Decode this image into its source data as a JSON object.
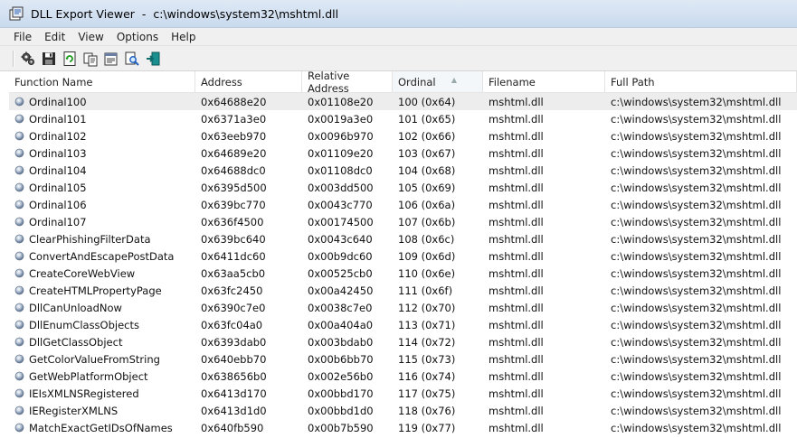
{
  "window": {
    "title": "DLL Export Viewer  -  c:\\windows\\system32\\mshtml.dll"
  },
  "menu": [
    "File",
    "Edit",
    "View",
    "Options",
    "Help"
  ],
  "toolbar": {
    "buttons": [
      "properties-gear-icon",
      "save-icon",
      "refresh-icon",
      "copy-icon",
      "html-report-icon",
      "find-icon",
      "exit-icon"
    ]
  },
  "table": {
    "columns": [
      "Function Name",
      "Address",
      "Relative Address",
      "Ordinal",
      "Filename",
      "Full Path"
    ],
    "sorted_column": "Ordinal",
    "rows": [
      [
        "Ordinal100",
        "0x64688e20",
        "0x01108e20",
        "100 (0x64)",
        "mshtml.dll",
        "c:\\windows\\system32\\mshtml.dll"
      ],
      [
        "Ordinal101",
        "0x6371a3e0",
        "0x0019a3e0",
        "101 (0x65)",
        "mshtml.dll",
        "c:\\windows\\system32\\mshtml.dll"
      ],
      [
        "Ordinal102",
        "0x63eeb970",
        "0x0096b970",
        "102 (0x66)",
        "mshtml.dll",
        "c:\\windows\\system32\\mshtml.dll"
      ],
      [
        "Ordinal103",
        "0x64689e20",
        "0x01109e20",
        "103 (0x67)",
        "mshtml.dll",
        "c:\\windows\\system32\\mshtml.dll"
      ],
      [
        "Ordinal104",
        "0x64688dc0",
        "0x01108dc0",
        "104 (0x68)",
        "mshtml.dll",
        "c:\\windows\\system32\\mshtml.dll"
      ],
      [
        "Ordinal105",
        "0x6395d500",
        "0x003dd500",
        "105 (0x69)",
        "mshtml.dll",
        "c:\\windows\\system32\\mshtml.dll"
      ],
      [
        "Ordinal106",
        "0x639bc770",
        "0x0043c770",
        "106 (0x6a)",
        "mshtml.dll",
        "c:\\windows\\system32\\mshtml.dll"
      ],
      [
        "Ordinal107",
        "0x636f4500",
        "0x00174500",
        "107 (0x6b)",
        "mshtml.dll",
        "c:\\windows\\system32\\mshtml.dll"
      ],
      [
        "ClearPhishingFilterData",
        "0x639bc640",
        "0x0043c640",
        "108 (0x6c)",
        "mshtml.dll",
        "c:\\windows\\system32\\mshtml.dll"
      ],
      [
        "ConvertAndEscapePostData",
        "0x6411dc60",
        "0x00b9dc60",
        "109 (0x6d)",
        "mshtml.dll",
        "c:\\windows\\system32\\mshtml.dll"
      ],
      [
        "CreateCoreWebView",
        "0x63aa5cb0",
        "0x00525cb0",
        "110 (0x6e)",
        "mshtml.dll",
        "c:\\windows\\system32\\mshtml.dll"
      ],
      [
        "CreateHTMLPropertyPage",
        "0x63fc2450",
        "0x00a42450",
        "111 (0x6f)",
        "mshtml.dll",
        "c:\\windows\\system32\\mshtml.dll"
      ],
      [
        "DllCanUnloadNow",
        "0x6390c7e0",
        "0x0038c7e0",
        "112 (0x70)",
        "mshtml.dll",
        "c:\\windows\\system32\\mshtml.dll"
      ],
      [
        "DllEnumClassObjects",
        "0x63fc04a0",
        "0x00a404a0",
        "113 (0x71)",
        "mshtml.dll",
        "c:\\windows\\system32\\mshtml.dll"
      ],
      [
        "DllGetClassObject",
        "0x6393dab0",
        "0x003bdab0",
        "114 (0x72)",
        "mshtml.dll",
        "c:\\windows\\system32\\mshtml.dll"
      ],
      [
        "GetColorValueFromString",
        "0x640ebb70",
        "0x00b6bb70",
        "115 (0x73)",
        "mshtml.dll",
        "c:\\windows\\system32\\mshtml.dll"
      ],
      [
        "GetWebPlatformObject",
        "0x638656b0",
        "0x002e56b0",
        "116 (0x74)",
        "mshtml.dll",
        "c:\\windows\\system32\\mshtml.dll"
      ],
      [
        "IEIsXMLNSRegistered",
        "0x6413d170",
        "0x00bbd170",
        "117 (0x75)",
        "mshtml.dll",
        "c:\\windows\\system32\\mshtml.dll"
      ],
      [
        "IERegisterXMLNS",
        "0x6413d1d0",
        "0x00bbd1d0",
        "118 (0x76)",
        "mshtml.dll",
        "c:\\windows\\system32\\mshtml.dll"
      ],
      [
        "MatchExactGetIDsOfNames",
        "0x640fb590",
        "0x00b7b590",
        "119 (0x77)",
        "mshtml.dll",
        "c:\\windows\\system32\\mshtml.dll"
      ]
    ]
  }
}
